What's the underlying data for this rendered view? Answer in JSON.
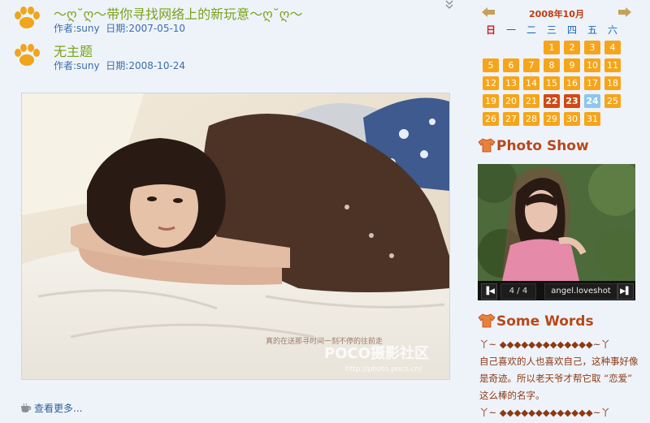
{
  "posts": [
    {
      "title": "～ღ˘ღ～带你寻找网络上的新玩意～ღ˘ღ～",
      "author_label": "作者:",
      "author": "suny",
      "date_label": "日期:",
      "date": "2007-05-10"
    },
    {
      "title": "无主题",
      "author_label": "作者:",
      "author": "suny",
      "date_label": "日期:",
      "date": "2008-10-24"
    }
  ],
  "photo": {
    "overlay_text": "真的在送那寻时间一刻不停的往前走",
    "watermark": "POCO摄影社区",
    "url_text": "http://photo.poco.cn/"
  },
  "more_link": "查看更多...",
  "calendar": {
    "title": "2008年10月",
    "weekdays": [
      "日",
      "一",
      "二",
      "三",
      "四",
      "五",
      "六"
    ],
    "weeks": [
      [
        null,
        null,
        null,
        "1",
        "2",
        "3",
        "4"
      ],
      [
        "5",
        "6",
        "7",
        "8",
        "9",
        "10",
        "11"
      ],
      [
        "12",
        "13",
        "14",
        "15",
        "16",
        "17",
        "18"
      ],
      [
        "19",
        "20",
        "21",
        "22",
        "23",
        "24",
        "25"
      ],
      [
        "26",
        "27",
        "28",
        "29",
        "30",
        "31",
        null
      ]
    ],
    "highlight_days": [
      "22",
      "23"
    ],
    "today": "24",
    "colors": {
      "day": "#f6a51a",
      "highlight": "#d14a13",
      "today": "#8ec7ec"
    }
  },
  "photo_show": {
    "title": "Photo Show",
    "counter": "4 / 4",
    "caption": "angel.loveshot"
  },
  "some_words": {
    "title": "Some Words",
    "lines": [
      "丫~ ◆◆◆◆◆◆◆◆◆◆◆◆◆~丫",
      "自己喜欢的人也喜欢自己，这种事好像是奇迹。所以老天爷才帮它取 “恋爱” 这么棒的名字。",
      "丫~ ◆◆◆◆◆◆◆◆◆◆◆◆◆~丫"
    ]
  }
}
